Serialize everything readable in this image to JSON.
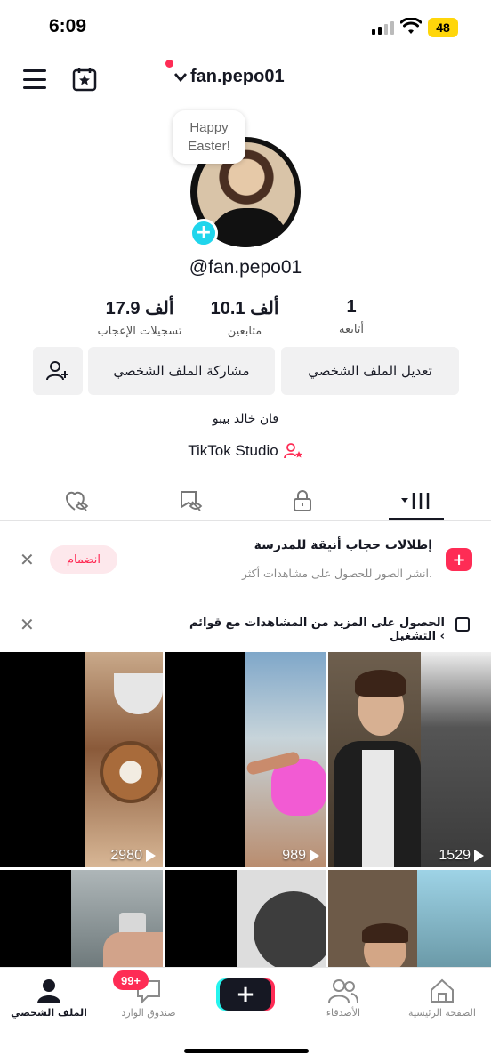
{
  "status": {
    "time": "6:09",
    "battery": "48"
  },
  "header": {
    "username": "fan.pepo01",
    "chevron": "⌄"
  },
  "profile": {
    "note": [
      "Happy",
      "Easter!"
    ],
    "handle": "@fan.pepo01",
    "stats": [
      {
        "num": "1",
        "label": "أتابعه"
      },
      {
        "num": "10.1 ألف",
        "label": "متابعين"
      },
      {
        "num": "17.9 ألف",
        "label": "تسجيلات الإعجاب"
      }
    ],
    "buttons": {
      "edit": "تعديل الملف الشخصي",
      "share": "مشاركة الملف الشخصي"
    },
    "bio": "فان خالد بيبو",
    "studio": "TikTok Studio"
  },
  "promo": {
    "title": "إطلالات حجاب أنيقة للمدرسة",
    "subtitle": "انشر الصور للحصول على مشاهدات أكثر.",
    "join": "انضمام"
  },
  "playlist": {
    "text": "الحصول على المزيد من المشاهدات مع قوائم التشغيل ‹"
  },
  "videos": [
    {
      "views": "2980"
    },
    {
      "views": "989"
    },
    {
      "views": "1529"
    }
  ],
  "nav": {
    "home": "الصفحة الرئيسية",
    "friends": "الأصدقاء",
    "inbox": "صندوق الوارد",
    "profile": "الملف الشخصي",
    "inbox_badge": "99+"
  },
  "colors": {
    "accent": "#fe2c55",
    "cyan": "#20d5ec"
  }
}
